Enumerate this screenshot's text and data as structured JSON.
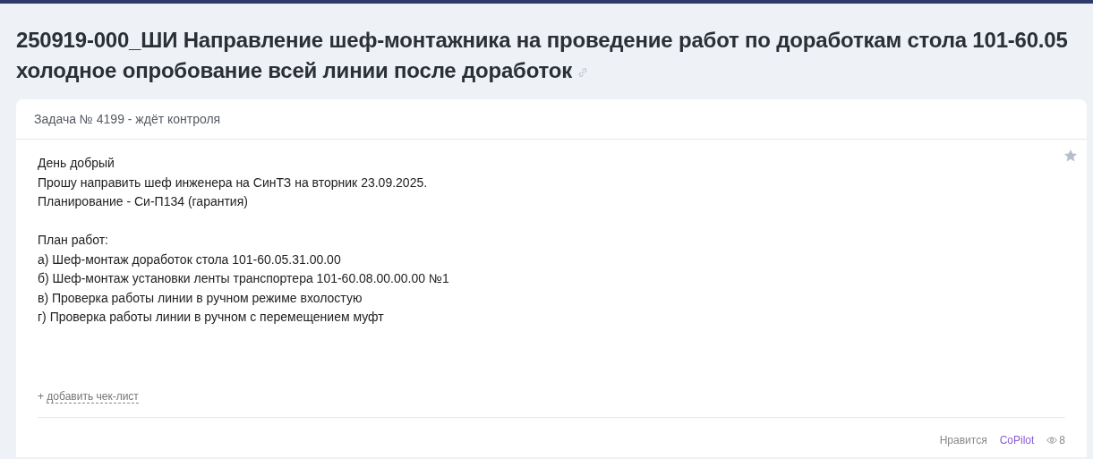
{
  "title_lines": [
    "250919-000_ШИ Направление шеф-монтажника на проведение работ по доработкам стола 101-60.05",
    "холодное опробование всей линии после доработок"
  ],
  "task": {
    "header": "Задача № 4199 - ждёт контроля",
    "paragraphs": [
      [
        "День добрый",
        "Прошу направить шеф инженера на СинТЗ на вторник 23.09.2025.",
        "Планирование - Си-П134 (гарантия)"
      ],
      [
        "План работ:",
        "а) Шеф-монтаж доработок стола 101-60.05.31.00.00",
        "б) Шеф-монтаж установки ленты транспортера 101-60.08.00.00.00 №1",
        "в) Проверка работы линии в ручном режиме вхолостую",
        "г) Проверка работы линии в ручном с перемещением муфт"
      ]
    ],
    "checklist_prefix": "+",
    "checklist_link": "добавить чек-лист",
    "footer": {
      "like": "Нравится",
      "copilot": "CoPilot",
      "views": "8"
    }
  }
}
